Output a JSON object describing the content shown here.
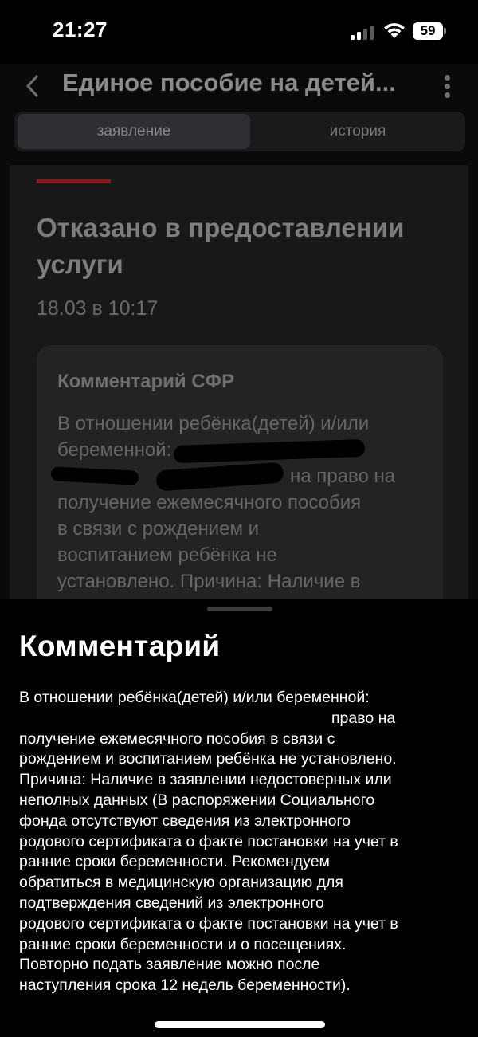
{
  "status_bar": {
    "time": "21:27",
    "battery": "59",
    "icons": [
      "signal-icon",
      "wifi-icon",
      "battery-icon"
    ]
  },
  "header": {
    "title": "Единое пособие на детей...",
    "back_icon": "chevron-left-icon",
    "more_icon": "more-vertical-icon"
  },
  "tabs": [
    {
      "label": "заявление",
      "active": true
    },
    {
      "label": "история",
      "active": false
    }
  ],
  "status_card": {
    "title": "Отказано в предоставлении услуги",
    "date": "18.03 в 10:17",
    "comment_title": "Комментарий СФР",
    "comment_lines": [
      "В отношении ребёнка(детей) и/или",
      "беременной: ",
      "на право на",
      "получение ежемесячного пособия",
      "в связи с рождением и",
      "воспитанием ребёнка не",
      "установлено. Причина: Наличие в"
    ]
  },
  "sheet": {
    "title": "Комментарий",
    "lines": [
      "В отношении ребёнка(детей) и/или беременной:",
      "право на",
      "получение ежемесячного пособия в связи с",
      "рождением и воспитанием ребёнка не установлено.",
      "Причина: Наличие в заявлении недостоверных или",
      "неполных данных (В распоряжении Социального",
      "фонда отсутствуют сведения из электронного",
      "родового сертификата о факте постановки на учет в",
      "ранние сроки беременности. Рекомендуем",
      "обратиться в медицинскую организацию для",
      "подтверждения сведений из электронного",
      "родового сертификата о факте постановки на учет в",
      "ранние сроки беременности и о посещениях.",
      "Повторно подать заявление можно после",
      "наступления срока 12 недель беременности)."
    ]
  },
  "colors": {
    "background": "#000000",
    "card": "#18181a",
    "accent_red": "#8b1a1a",
    "text_primary": "#ffffff"
  }
}
